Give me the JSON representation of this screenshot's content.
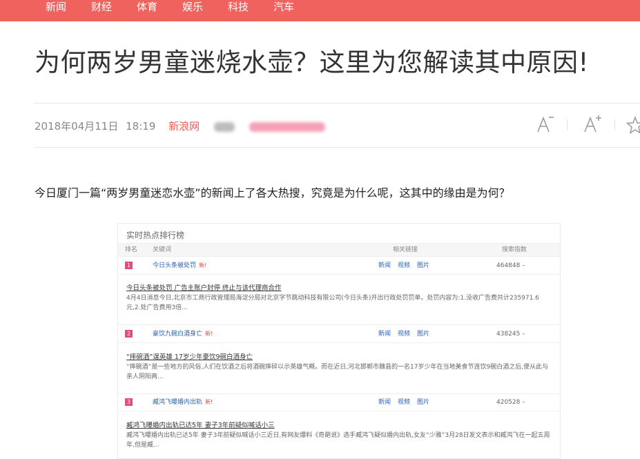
{
  "nav": [
    {
      "label": "新闻"
    },
    {
      "label": "财经"
    },
    {
      "label": "体育"
    },
    {
      "label": "娱乐"
    },
    {
      "label": "科技"
    },
    {
      "label": "汽车"
    }
  ],
  "article": {
    "title": "为何两岁男童迷烧水壶？这里为您解读其中原因!",
    "date": "2018年04月11日",
    "time": "18:19",
    "source": "新浪网",
    "lead": "今日厦门一篇“两岁男童迷恋水壶”的新闻上了各大热搜，究竟是为什么呢，这其中的缘由是为何？"
  },
  "colors": {
    "accent": "#f0625d",
    "source": "#ef5b55",
    "link": "#2a64b3"
  },
  "hotlist": {
    "title": "实时热点排行榜",
    "headers": {
      "rank": "排名",
      "keyword": "关键词",
      "links": "相关链接",
      "count": "搜索指数"
    },
    "link_labels": {
      "news": "新闻",
      "video": "视频",
      "image": "图片"
    },
    "hot_tag": "新!",
    "items": [
      {
        "rank": "1",
        "keyword": "今日头条被处罚",
        "count": "464848 –",
        "detail_title": "今日头条被处罚 广告主账户封停 终止与该代理商合作",
        "detail_text": "4月4日消息今日,北京市工商行政管理局海淀分局对北京字节跳动科技有限公司(今日头条)开出行政处罚罚单。处罚内容为:1.没收广告费共计235971.6元,2.处广告费用3倍..."
      },
      {
        "rank": "2",
        "keyword": "豪饮九碗白酒身亡",
        "count": "438245 –",
        "detail_title": "“摔碗酒”逞英雄 17岁少年豪饮9碗白酒身亡",
        "detail_text": "“摔碗酒”是一些地方的风俗,人们在饮酒之后将酒碗摔碎以示英雄气概。而在近日,河北邯郸市魏县的一名17岁少年在当地美食节连饮9碗白酒之后,便从此与亲人阴阳两..."
      },
      {
        "rank": "3",
        "keyword": "臧鸿飞曝婚内出轨",
        "count": "420528 –",
        "detail_title": "臧鸿飞曝婚内出轨已达5年 妻子3年前疑似喊话小三",
        "detail_text": "臧鸿飞曝婚内出轨已达5年 妻子3年前疑似喊话小三近日,有网友爆料《奇葩说》选手臧鸿飞疑似婚内出轨,女友“少雅”3月28日发文表示和臧鸿飞在一起五周年,但是臧..."
      }
    ]
  }
}
